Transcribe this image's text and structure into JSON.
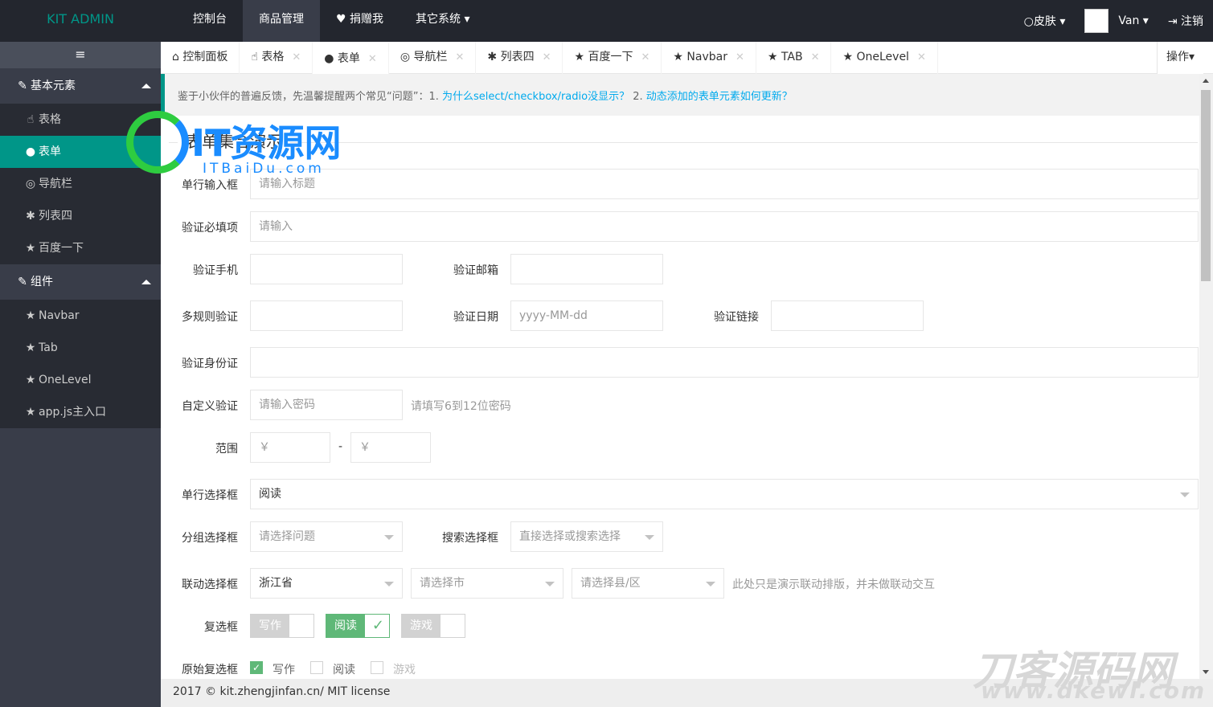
{
  "header": {
    "logo": "KIT ADMIN",
    "nav": [
      "控制台",
      "商品管理",
      "捐赠我",
      "其它系统"
    ],
    "skin": "皮肤",
    "user": "Van",
    "logout": "注销"
  },
  "sidebar": {
    "toggle": "≡",
    "group1": {
      "label": "基本元素",
      "items": [
        "表格",
        "表单",
        "导航栏",
        "列表四",
        "百度一下"
      ]
    },
    "group2": {
      "label": "组件",
      "items": [
        "Navbar",
        "Tab",
        "OneLevel",
        "app.js主入口"
      ]
    }
  },
  "tabs": [
    "控制面板",
    "表格",
    "表单",
    "导航栏",
    "列表四",
    "百度一下",
    "Navbar",
    "TAB",
    "OneLevel"
  ],
  "tab_ops": "操作",
  "notice": {
    "text": "鉴于小伙伴的普遍反馈，先温馨提醒两个常见“问题”：1.",
    "link1": "为什么select/checkbox/radio没显示？",
    "mid": "2.",
    "link2": "动态添加的表单元素如何更新？"
  },
  "form": {
    "legend": "表单集合演示",
    "title_label": "单行输入框",
    "title_placeholder": "请输入标题",
    "required_label": "验证必填项",
    "required_placeholder": "请输入",
    "phone_label": "验证手机",
    "email_label": "验证邮箱",
    "multi_label": "多规则验证",
    "date_label": "验证日期",
    "date_placeholder": "yyyy-MM-dd",
    "url_label": "验证链接",
    "id_label": "验证身份证",
    "custom_label": "自定义验证",
    "custom_placeholder": "请输入密码",
    "custom_hint": "请填写6到12位密码",
    "range_label": "范围",
    "range_min": "￥",
    "range_sep": "-",
    "range_max": "￥",
    "select_label": "单行选择框",
    "select_value": "阅读",
    "group_label": "分组选择框",
    "group_placeholder": "请选择问题",
    "search_label": "搜索选择框",
    "search_placeholder": "直接选择或搜索选择",
    "linkage_label": "联动选择框",
    "province": "浙江省",
    "city": "请选择市",
    "county": "请选择县/区",
    "linkage_hint": "此处只是演示联动排版，并未做联动交互",
    "checkbox_label": "复选框",
    "checkboxes": [
      "写作",
      "阅读",
      "游戏"
    ],
    "native_label": "原始复选框",
    "native_boxes": [
      "写作",
      "阅读",
      "游戏"
    ]
  },
  "footer": "2017 © kit.zhengjinfan.cn/ MIT license",
  "watermark1": {
    "title": "IT资源网",
    "sub": "ITBaiDu.com"
  },
  "watermark2": {
    "title": "刀客源码网",
    "sub": "www.dkewl.com"
  },
  "colors": {
    "accent": "#009688",
    "header": "#23262e",
    "sidebar": "#393d49",
    "check": "#5fb878",
    "link": "#01aaed"
  }
}
